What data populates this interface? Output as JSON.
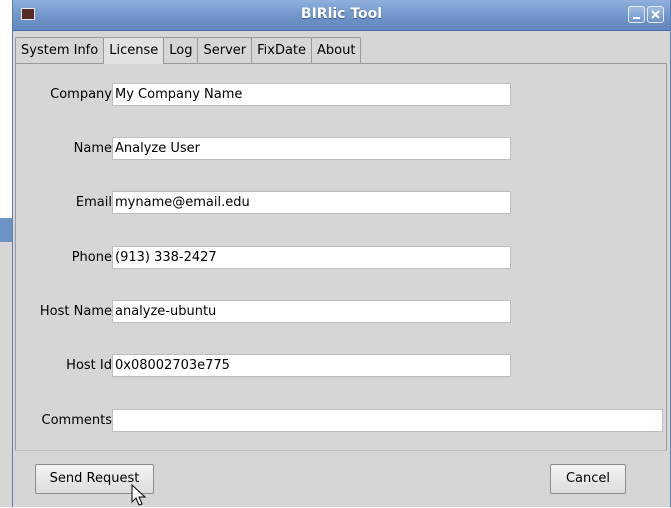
{
  "window": {
    "title": "BIRlic Tool",
    "minimize_icon": "minimize-icon",
    "close_icon": "close-icon"
  },
  "tabs": [
    {
      "label": "System Info",
      "active": false
    },
    {
      "label": "License",
      "active": true
    },
    {
      "label": "Log",
      "active": false
    },
    {
      "label": "Server",
      "active": false
    },
    {
      "label": "FixDate",
      "active": false
    },
    {
      "label": "About",
      "active": false
    }
  ],
  "form": {
    "company": {
      "label": "Company",
      "value": "My Company Name"
    },
    "name": {
      "label": "Name",
      "value": "Analyze User"
    },
    "email": {
      "label": "Email",
      "value": "myname@email.edu"
    },
    "phone": {
      "label": "Phone",
      "value": "(913) 338-2427"
    },
    "host_name": {
      "label": "Host Name",
      "value": "analyze-ubuntu"
    },
    "host_id": {
      "label": "Host Id",
      "value": "0x08002703e775"
    },
    "comments": {
      "label": "Comments",
      "value": ""
    }
  },
  "buttons": {
    "send_request": "Send Request",
    "cancel": "Cancel"
  },
  "colors": {
    "titlebar": "#6f95ca",
    "window_bg": "#d6d6d6"
  }
}
